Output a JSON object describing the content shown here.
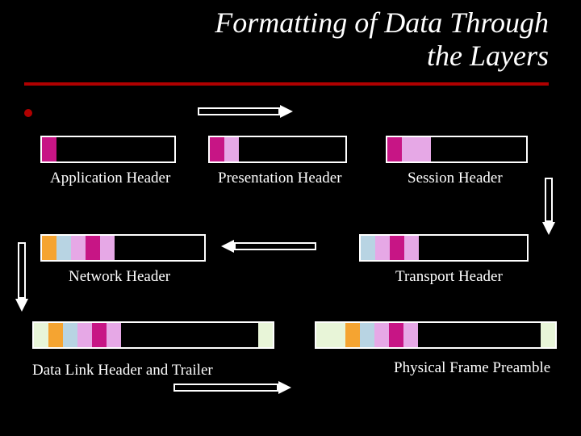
{
  "title_line1": "Formatting of Data Through",
  "title_line2": "the Layers",
  "labels": {
    "application": "Application Header",
    "presentation": "Presentation Header",
    "session": "Session Header",
    "network": "Network Header",
    "transport": "Transport Header",
    "datalink": "Data Link Header and Trailer",
    "physical": "Physical Frame Preamble"
  }
}
